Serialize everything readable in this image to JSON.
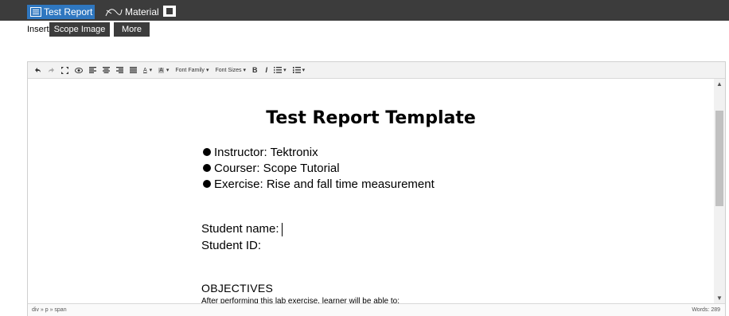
{
  "tabs": [
    {
      "label": "Test Report",
      "icon": "list-icon",
      "active": true
    },
    {
      "label": "Material",
      "icon": "probe-icon",
      "active": false
    }
  ],
  "export_icon": "export-icon",
  "insert": {
    "label": "Insert",
    "scope_image": "Scope Image",
    "more": "More"
  },
  "toolbar": {
    "text_color": "A",
    "bg_color": "A",
    "font_family": "Font Family",
    "font_sizes": "Font Sizes",
    "bold": "B",
    "italic": "I",
    "icons": [
      "undo-icon",
      "redo-icon",
      "fullscreen-icon",
      "preview-icon",
      "align-left-icon",
      "align-center-icon",
      "align-right-icon",
      "justify-icon",
      "text-color-icon",
      "background-color-icon",
      "bullet-list-icon",
      "numbered-list-icon"
    ]
  },
  "document": {
    "title": "Test Report Template",
    "bullets": [
      "Instructor: Tektronix",
      "Courser: Scope Tutorial",
      "Exercise: Rise and fall time measurement"
    ],
    "student_name": "Student name:",
    "student_id": "Student ID:",
    "objectives": "OBJECTIVES",
    "after": "After performing this lab exercise, learner will be able to:"
  },
  "status": {
    "path": "div » p » span",
    "words": "Words: 289"
  }
}
